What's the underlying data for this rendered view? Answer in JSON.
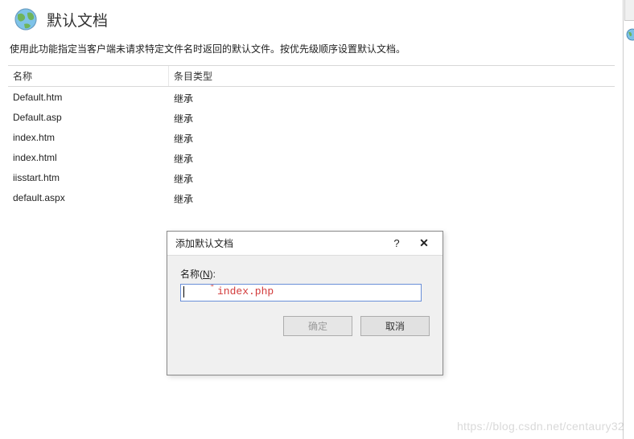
{
  "header": {
    "title": "默认文档"
  },
  "description": "使用此功能指定当客户端未请求特定文件名时返回的默认文件。按优先级顺序设置默认文档。",
  "columns": {
    "name": "名称",
    "type": "条目类型"
  },
  "rows": [
    {
      "name": "Default.htm",
      "type": "继承"
    },
    {
      "name": "Default.asp",
      "type": "继承"
    },
    {
      "name": "index.htm",
      "type": "继承"
    },
    {
      "name": "index.html",
      "type": "继承"
    },
    {
      "name": "iisstart.htm",
      "type": "继承"
    },
    {
      "name": "default.aspx",
      "type": "继承"
    }
  ],
  "dialog": {
    "title": "添加默认文档",
    "help_symbol": "?",
    "close_symbol": "✕",
    "field_label_prefix": "名称(",
    "field_label_accel": "N",
    "field_label_suffix": "):",
    "input_value": "",
    "hint": "index.php",
    "ok": "确定",
    "cancel": "取消"
  },
  "watermark": "https://blog.csdn.net/centaury32"
}
